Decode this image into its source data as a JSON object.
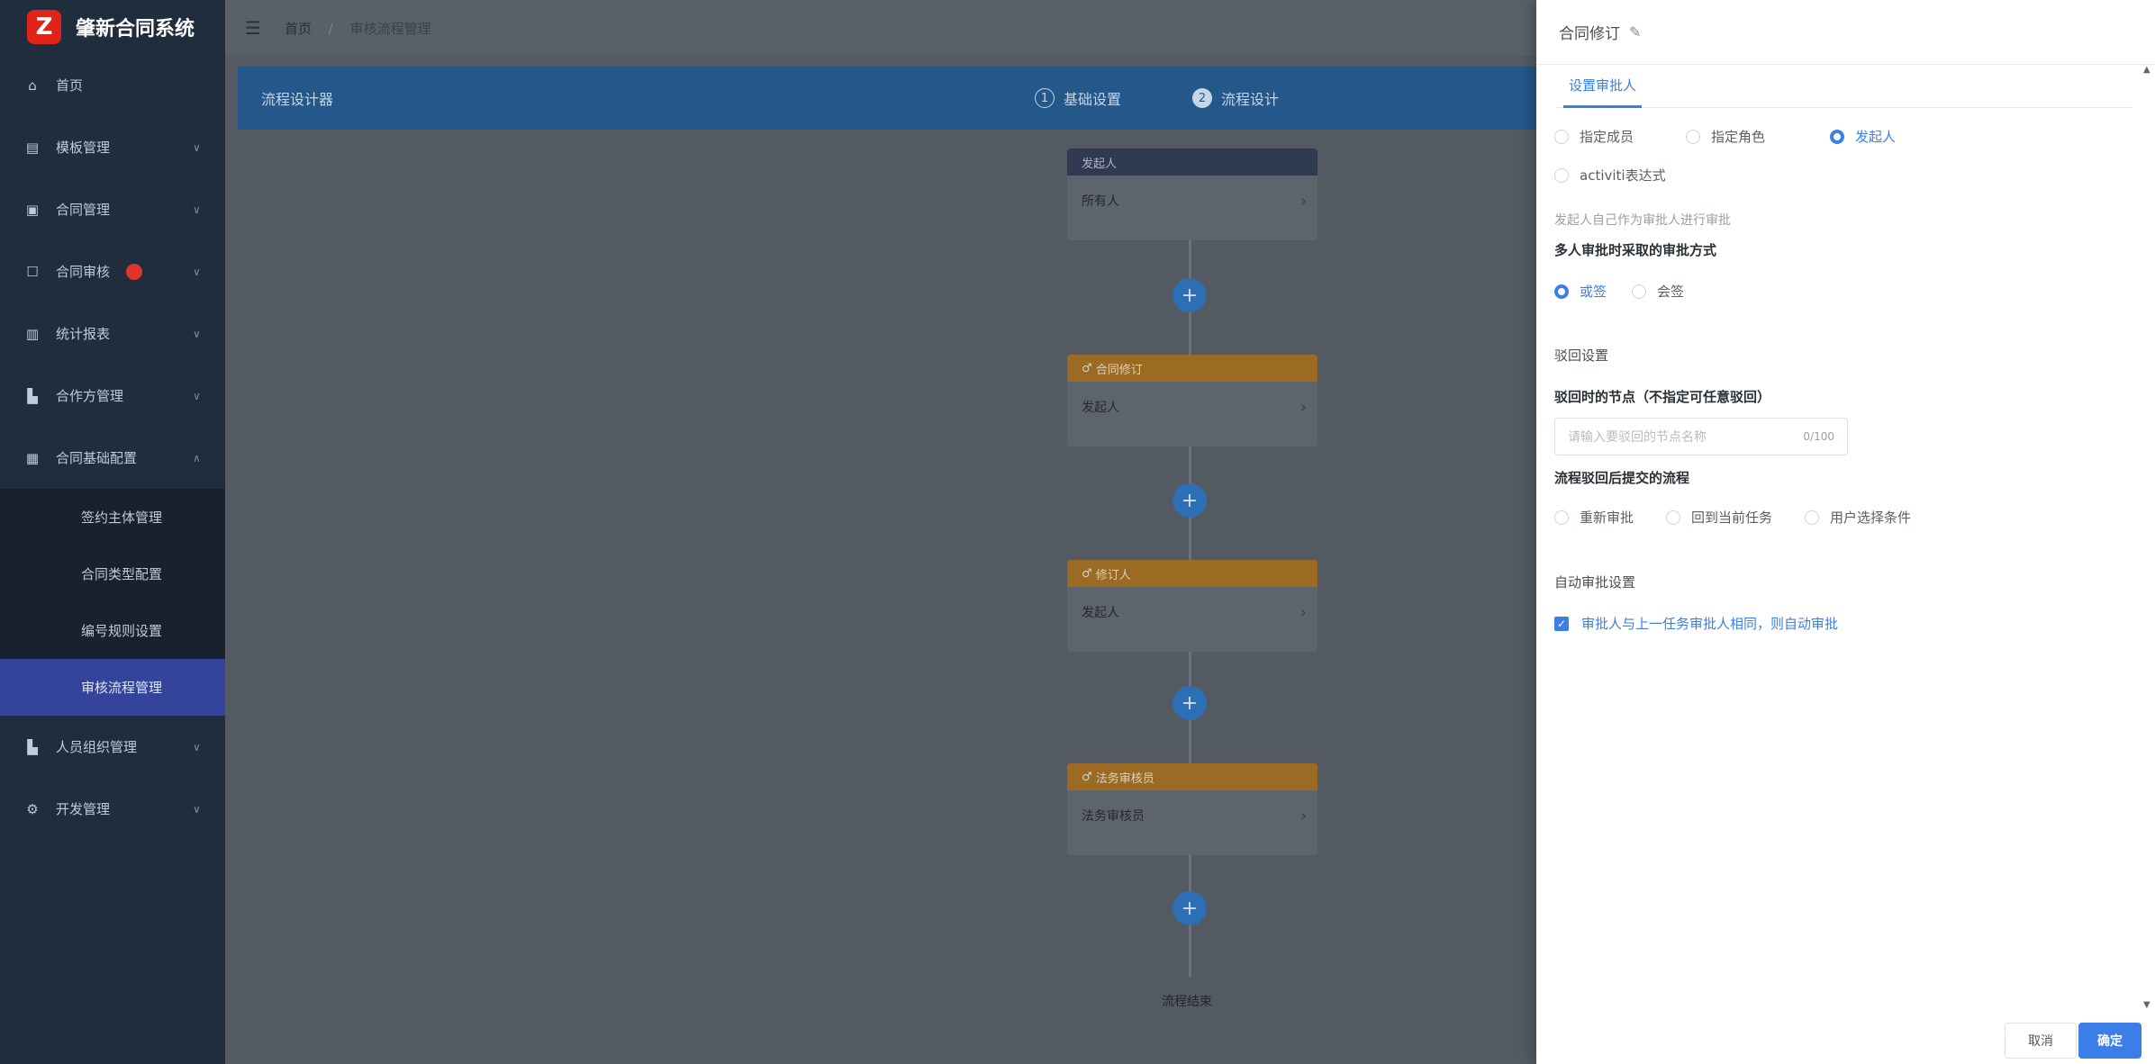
{
  "app": {
    "title": "肇新合同系统",
    "logo_glyph": "Z",
    "brand_color": "#e2231a",
    "accent": "#3c7ee8"
  },
  "sidebar": {
    "items": [
      {
        "label": "首页",
        "icon": "home-icon",
        "glyph": "⌂"
      },
      {
        "label": "模板管理",
        "icon": "template-icon",
        "glyph": "▤"
      },
      {
        "label": "合同管理",
        "icon": "contract-icon",
        "glyph": "▣"
      },
      {
        "label": "合同审核",
        "icon": "review-icon",
        "glyph": "☐"
      },
      {
        "label": "统计报表",
        "icon": "chart-icon",
        "glyph": "▥"
      },
      {
        "label": "合作方管理",
        "icon": "partner-icon",
        "glyph": "▙"
      },
      {
        "label": "合同基础配置",
        "icon": "config-icon",
        "glyph": "▦"
      },
      {
        "label": "人员组织管理",
        "icon": "org-icon",
        "glyph": "▙"
      },
      {
        "label": "开发管理",
        "icon": "dev-icon",
        "glyph": "⚙"
      }
    ],
    "submenu": [
      {
        "label": "签约主体管理"
      },
      {
        "label": "合同类型配置"
      },
      {
        "label": "编号规则设置"
      },
      {
        "label": "审核流程管理"
      }
    ]
  },
  "breadcrumb": {
    "home": "首页",
    "current": "审核流程管理"
  },
  "designer": {
    "title": "流程设计器",
    "step1_num": "1",
    "step1_label": "基础设置",
    "step2_num": "2",
    "step2_label": "流程设计"
  },
  "flow": {
    "nodes": [
      {
        "title": "发起人",
        "body": "所有人"
      },
      {
        "title": "合同修订",
        "body": "发起人"
      },
      {
        "title": "修订人",
        "body": "发起人"
      },
      {
        "title": "法务审核员",
        "body": "法务审核员"
      }
    ],
    "add_glyph": "+",
    "end_label": "流程结束"
  },
  "drawer": {
    "title": "合同修订",
    "tab": "设置审批人",
    "assignee_options": [
      "指定成员",
      "指定角色",
      "发起人",
      "activiti表达式"
    ],
    "selected_assignee": "发起人",
    "assignee_hint": "发起人自己作为审批人进行审批",
    "multi_label": "多人审批时采取的审批方式",
    "multi_options": [
      "或签",
      "会签"
    ],
    "selected_multi": "或签",
    "reject_title": "驳回设置",
    "reject_nodes_label": "驳回时的节点（不指定可任意驳回）",
    "reject_input_placeholder": "请输入要驳回的节点名称",
    "reject_input_count": "0/100",
    "resubmit_label": "流程驳回后提交的流程",
    "resubmit_options": [
      "重新审批",
      "回到当前任务",
      "用户选择条件"
    ],
    "auto_title": "自动审批设置",
    "auto_checkbox": "审批人与上一任务审批人相同，则自动审批",
    "cancel": "取消",
    "ok": "确定"
  }
}
